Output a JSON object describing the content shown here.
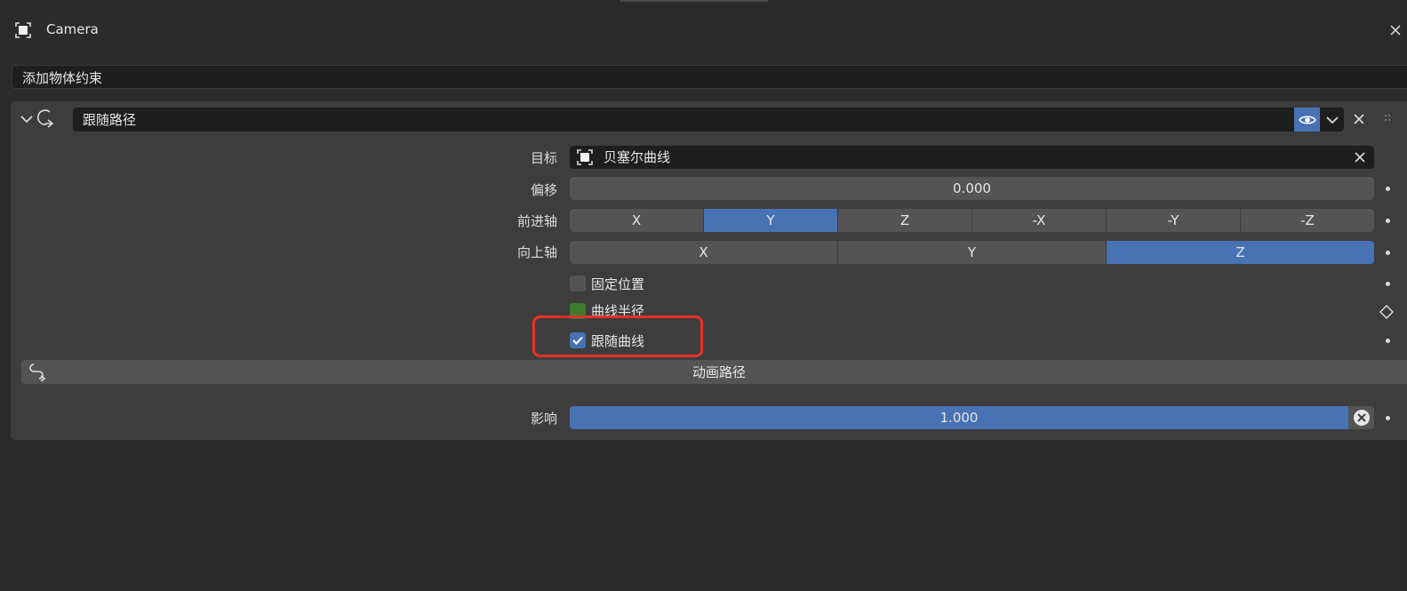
{
  "header": {
    "title": "Camera",
    "object_icon": "object-data-icon",
    "corner_icon": "panel-close-icon"
  },
  "add_constraint": {
    "label": "添加物体约束"
  },
  "constraint": {
    "collapse_icon": "chevron-down-icon",
    "type_icon": "follow-path-constraint-icon",
    "name": "跟随路径",
    "visibility_icon": "eye-icon",
    "menu_icon": "chevron-down-icon",
    "delete_icon": "close-icon",
    "drag_icon": "drag-handle-icon",
    "target": {
      "label": "目标",
      "value": "贝塞尔曲线",
      "value_icon": "curve-object-icon",
      "clear_icon": "close-icon"
    },
    "offset": {
      "label": "偏移",
      "value": "0.000"
    },
    "forward_axis": {
      "label": "前进轴",
      "options": [
        "X",
        "Y",
        "Z",
        "-X",
        "-Y",
        "-Z"
      ],
      "selected": "Y"
    },
    "up_axis": {
      "label": "向上轴",
      "options": [
        "X",
        "Y",
        "Z"
      ],
      "selected": "Z"
    },
    "fixed_position": {
      "label": "固定位置",
      "checked": false
    },
    "curve_radius": {
      "label": "曲线半径",
      "checked": true
    },
    "follow_curve": {
      "label": "跟随曲线",
      "checked": true
    },
    "animate_path": {
      "label": "动画路径",
      "icon": "animate-path-icon"
    },
    "influence": {
      "label": "影响",
      "value": "1.000",
      "fraction": 1.0
    }
  },
  "colors": {
    "accent": "#4772b3",
    "highlight_box": "#e8302a",
    "curve_radius_check": "#3f7b2a"
  }
}
